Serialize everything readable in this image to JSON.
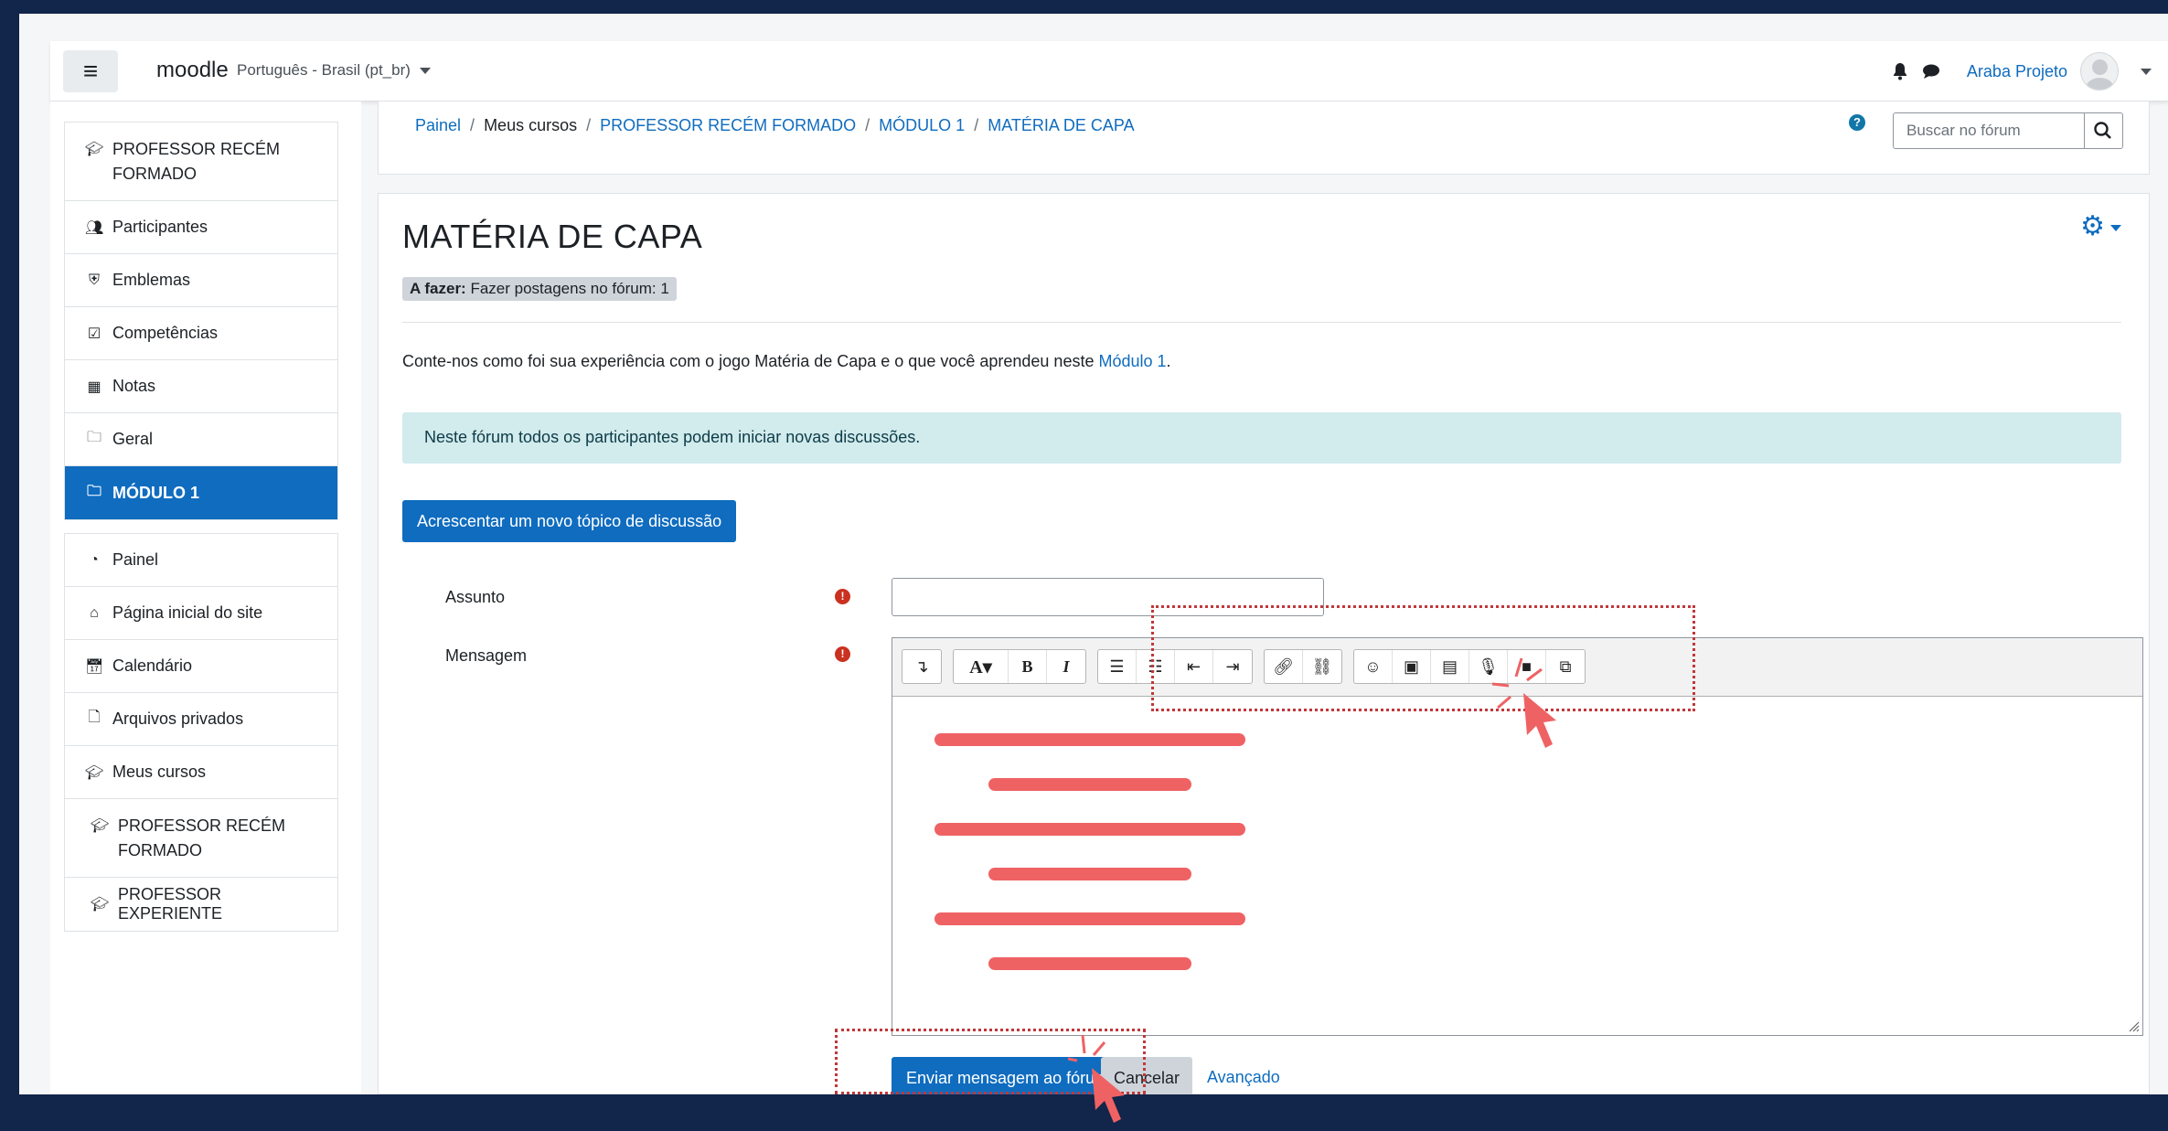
{
  "navbar": {
    "brand": "moodle",
    "language": "Português - Brasil (pt_br)",
    "user_name": "Araba Projeto"
  },
  "drawer": {
    "course_items": [
      {
        "label": "PROFESSOR RECÉM FORMADO",
        "icon": "graduation-cap-icon"
      },
      {
        "label": "Participantes",
        "icon": "users-icon"
      },
      {
        "label": "Emblemas",
        "icon": "shield-icon"
      },
      {
        "label": "Competências",
        "icon": "checkbox-icon"
      },
      {
        "label": "Notas",
        "icon": "table-icon"
      },
      {
        "label": "Geral",
        "icon": "folder-icon"
      },
      {
        "label": "MÓDULO 1",
        "icon": "folder-icon",
        "active": true
      }
    ],
    "site_items": [
      {
        "label": "Painel",
        "icon": "dashboard-icon"
      },
      {
        "label": "Página inicial do site",
        "icon": "home-icon"
      },
      {
        "label": "Calendário",
        "icon": "calendar-icon"
      },
      {
        "label": "Arquivos privados",
        "icon": "file-icon"
      },
      {
        "label": "Meus cursos",
        "icon": "graduation-cap-icon"
      },
      {
        "label": "PROFESSOR RECÉM FORMADO",
        "icon": "graduation-cap-icon"
      },
      {
        "label": "PROFESSOR EXPERIENTE",
        "icon": "graduation-cap-icon"
      }
    ]
  },
  "breadcrumb": [
    "Painel",
    "Meus cursos",
    "PROFESSOR RECÉM FORMADO",
    "MÓDULO 1",
    "MATÉRIA DE CAPA"
  ],
  "search": {
    "placeholder": "Buscar no fórum"
  },
  "page": {
    "title": "MATÉRIA DE CAPA",
    "todo_label": "A fazer:",
    "todo_text": "Fazer postagens no fórum: 1",
    "intro_text": "Conte-nos como foi sua experiência com o jogo Matéria de Capa e o que você aprendeu neste",
    "intro_link": "Módulo 1",
    "intro_end": ".",
    "alert": "Neste fórum todos os participantes podem iniciar novas discussões.",
    "add_topic_button": "Acrescentar um novo tópico de discussão"
  },
  "form": {
    "subject_label": "Assunto",
    "subject_value": "",
    "message_label": "Mensagem",
    "submit_button": "Enviar mensagem ao fórum",
    "cancel_button": "Cancelar",
    "advanced_link": "Avançado"
  },
  "colors": {
    "primary": "#0f6cbf",
    "annotation": "#ef6264",
    "frame_bg": "#12254a",
    "alert_bg": "#d2ebed"
  }
}
